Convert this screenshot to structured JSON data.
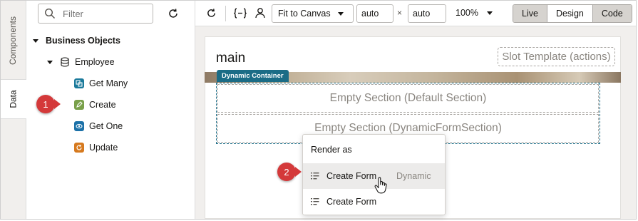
{
  "side_tabs": {
    "components": "Components",
    "data": "Data"
  },
  "panel": {
    "filter_placeholder": "Filter",
    "tree": {
      "root": "Business Objects",
      "object": "Employee",
      "endpoints": [
        {
          "label": "Get Many",
          "icon": "get-many-icon"
        },
        {
          "label": "Create",
          "icon": "create-pencil-icon"
        },
        {
          "label": "Get One",
          "icon": "get-one-eye-icon"
        },
        {
          "label": "Update",
          "icon": "update-icon"
        }
      ]
    }
  },
  "toolbar": {
    "fit_label": "Fit to Canvas",
    "width_value": "auto",
    "times": "×",
    "height_value": "auto",
    "zoom": "100%",
    "modes": [
      "Live",
      "Design",
      "Code"
    ],
    "selected_modes": [
      "Live",
      "Code"
    ]
  },
  "canvas": {
    "page_title": "main",
    "slot_template": "Slot Template (actions)",
    "dynamic_tag": "Dynamic Container",
    "section_default": "Empty Section (Default Section)",
    "section_form": "Empty Section (DynamicFormSection)"
  },
  "menu": {
    "heading": "Render as",
    "items": [
      {
        "label": "Create Form",
        "sublabel": "Dynamic"
      },
      {
        "label": "Create Form"
      }
    ]
  },
  "callouts": [
    "1",
    "2"
  ],
  "colors": {
    "teal": "#1b6c86",
    "callout_red": "#d4393a"
  }
}
